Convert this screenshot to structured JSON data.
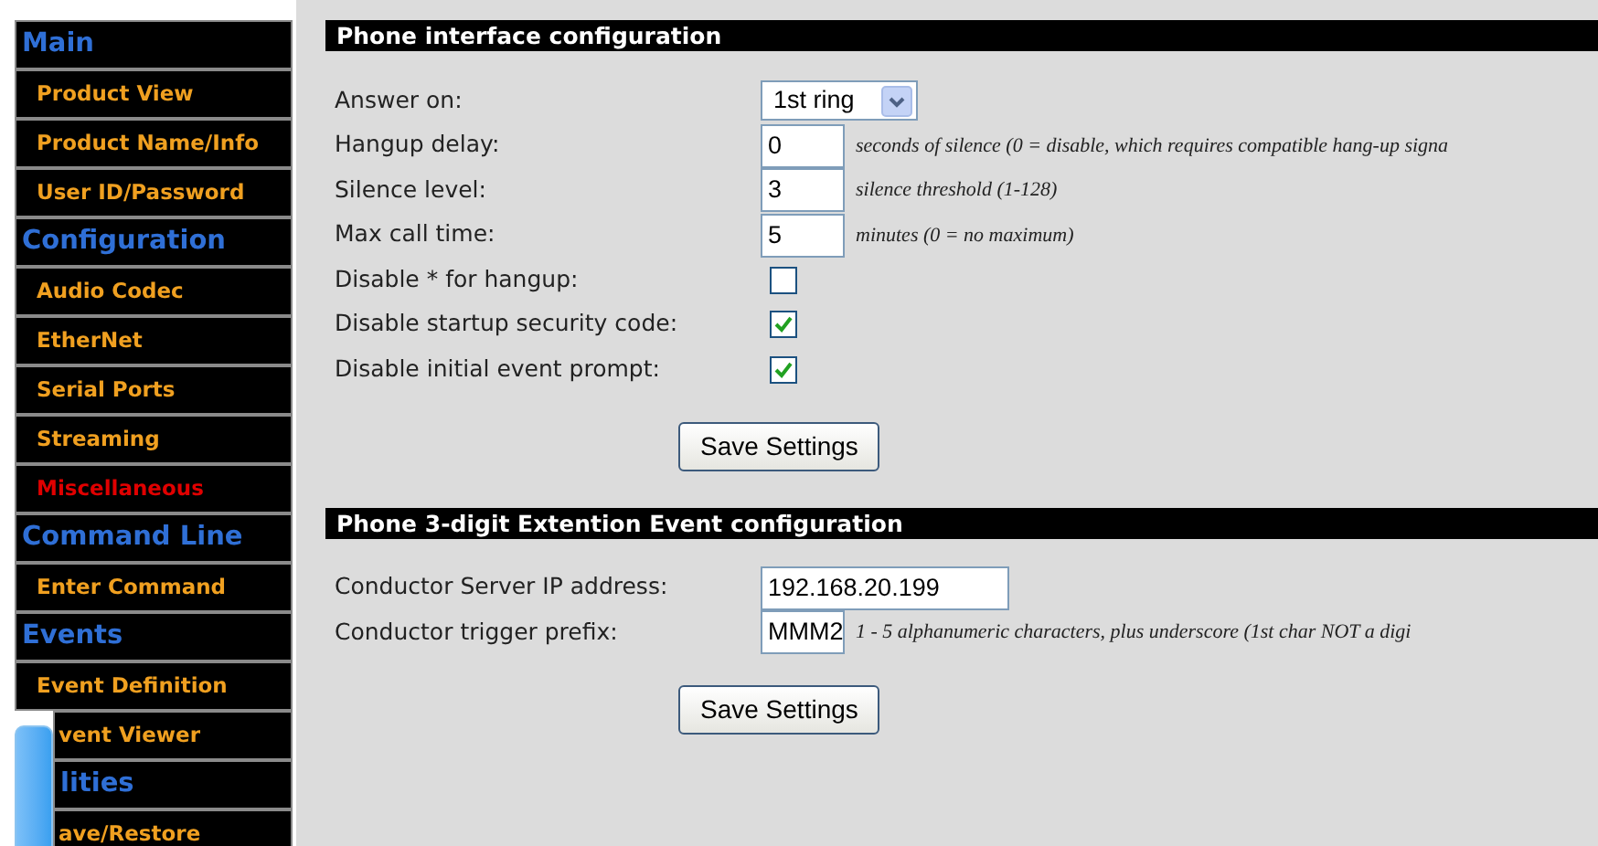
{
  "sidebar": {
    "items": [
      {
        "kind": "heading",
        "label": "Main"
      },
      {
        "kind": "link",
        "label": "Product View",
        "selected": false
      },
      {
        "kind": "link",
        "label": "Product Name/Info",
        "selected": false
      },
      {
        "kind": "link",
        "label": "User ID/Password",
        "selected": false
      },
      {
        "kind": "heading",
        "label": "Configuration"
      },
      {
        "kind": "link",
        "label": "Audio Codec",
        "selected": false
      },
      {
        "kind": "link",
        "label": "EtherNet",
        "selected": false
      },
      {
        "kind": "link",
        "label": "Serial Ports",
        "selected": false
      },
      {
        "kind": "link",
        "label": "Streaming",
        "selected": false
      },
      {
        "kind": "link",
        "label": "Miscellaneous",
        "selected": true
      },
      {
        "kind": "heading",
        "label": "Command Line"
      },
      {
        "kind": "link",
        "label": "Enter Command",
        "selected": false
      },
      {
        "kind": "heading",
        "label": "Events"
      },
      {
        "kind": "link",
        "label": "Event Definition",
        "selected": false
      },
      {
        "kind": "link",
        "label": "vent Viewer",
        "selected": false,
        "covered": true
      },
      {
        "kind": "heading",
        "label": "lities",
        "covered": true
      },
      {
        "kind": "link",
        "label": "ave/Restore",
        "selected": false,
        "covered": true
      }
    ]
  },
  "sections": [
    {
      "title": "Phone interface configuration",
      "fields": [
        {
          "kind": "select",
          "label": "Answer on:",
          "value": "1st ring"
        },
        {
          "kind": "text",
          "label": "Hangup delay:",
          "value": "0",
          "hint": "seconds of silence (0 = disable, which requires compatible hang-up signa"
        },
        {
          "kind": "text",
          "label": "Silence level:",
          "value": "3",
          "hint": "silence threshold (1-128)"
        },
        {
          "kind": "text",
          "label": "Max call time:",
          "value": "5",
          "hint": "minutes (0 = no maximum)"
        },
        {
          "kind": "checkbox",
          "label": "Disable * for hangup:",
          "checked": false
        },
        {
          "kind": "checkbox",
          "label": "Disable startup security code:",
          "checked": true
        },
        {
          "kind": "checkbox",
          "label": "Disable initial event prompt:",
          "checked": true
        }
      ],
      "button": "Save Settings"
    },
    {
      "title": "Phone 3-digit Extention Event configuration",
      "fields": [
        {
          "kind": "text",
          "label": "Conductor Server IP address:",
          "value": "192.168.20.199"
        },
        {
          "kind": "text",
          "label": "Conductor trigger prefix:",
          "value": "MMM2",
          "hint": "1 - 5 alphanumeric characters, plus underscore (1st char NOT a digi"
        }
      ],
      "button": "Save Settings"
    }
  ]
}
